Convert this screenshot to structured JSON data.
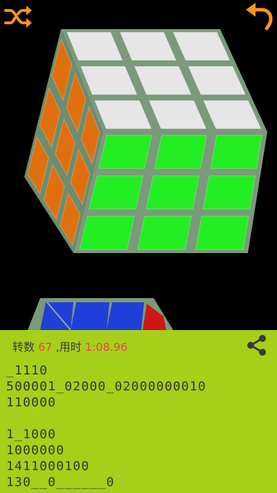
{
  "toolbar": {
    "shuffle_icon": "shuffle-icon",
    "undo_icon": "undo-icon",
    "accent_color": "#f7931e"
  },
  "cube": {
    "top_face": [
      "white",
      "white",
      "white",
      "white",
      "white",
      "white",
      "white",
      "white",
      "white"
    ],
    "front_face": [
      "green",
      "green",
      "green",
      "green",
      "green",
      "green",
      "green",
      "green",
      "green"
    ],
    "left_face": [
      "orange",
      "orange",
      "orange",
      "orange",
      "orange",
      "orange",
      "orange",
      "orange",
      "orange"
    ],
    "second_cube_visible": [
      "blue",
      "blue",
      "blue",
      "red"
    ]
  },
  "stats": {
    "moves_label": "转数",
    "moves_value": "67",
    "time_label": ",用时",
    "time_value": "1:08.96"
  },
  "share_icon": "share-icon",
  "log": {
    "lines": [
      "_1110",
      "500001_02000_02000000010",
      "110000",
      "",
      "1_1000",
      "1000000",
      "1411000100",
      "130__0______0"
    ]
  },
  "colors": {
    "panel_bg": "#a6cf1a",
    "highlight_red": "#e8484c",
    "white": "#e6e6e6",
    "green": "#22ee22",
    "orange": "#e0700f",
    "blue": "#1f3fd8",
    "red": "#d01515"
  }
}
